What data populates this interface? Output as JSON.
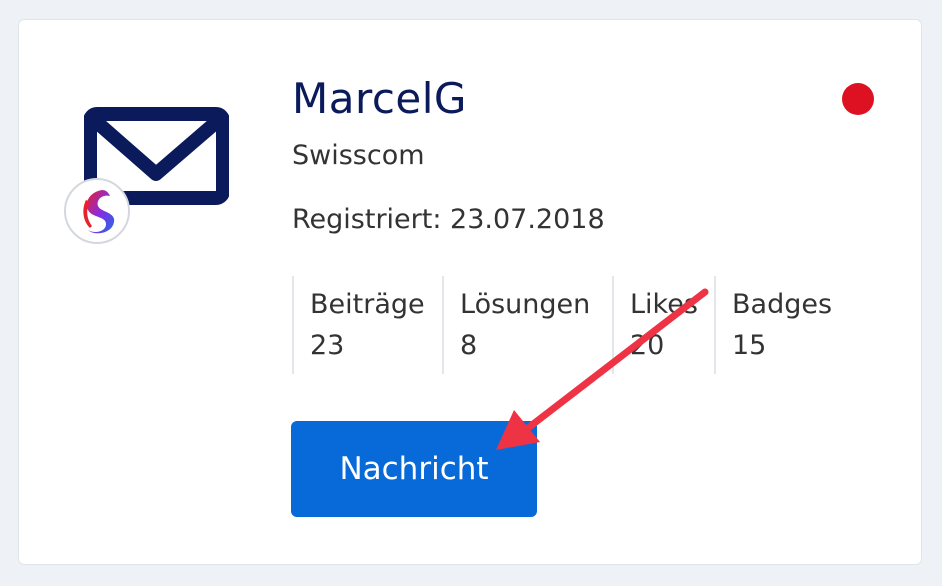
{
  "profile": {
    "username": "MarcelG",
    "company": "Swisscom",
    "registered_label": "Registriert:",
    "registered_date": "23.07.2018",
    "avatar_icon": "envelope-icon",
    "brand_icon": "swisscom-logo-icon",
    "status_color": "#dd1122"
  },
  "stats": [
    {
      "label": "Beiträge",
      "value": "23"
    },
    {
      "label": "Lösungen",
      "value": "8"
    },
    {
      "label": "Likes",
      "value": "20"
    },
    {
      "label": "Badges",
      "value": "15"
    }
  ],
  "actions": {
    "message_label": "Nachricht"
  },
  "colors": {
    "accent": "#086ad8",
    "title": "#0a1a5a",
    "annotation": "#ee3344"
  }
}
